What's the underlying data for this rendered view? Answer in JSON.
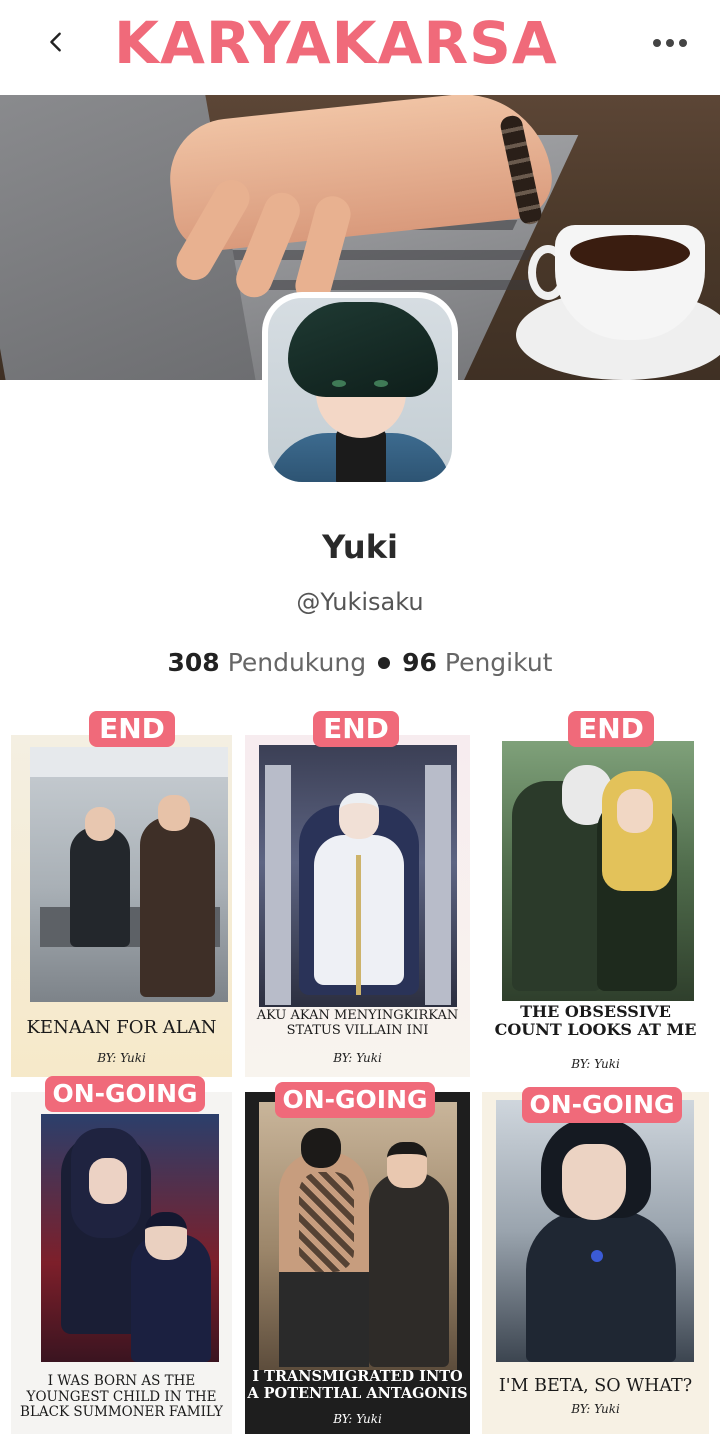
{
  "header": {
    "title": "KARYAKARSA",
    "back_icon": "chevron-left-icon",
    "more_icon": "more-horizontal-icon",
    "accent_color": "#f06a7a"
  },
  "profile": {
    "name": "Yuki",
    "handle": "@Yukisaku",
    "supporters_count": "308",
    "supporters_label": "Pendukung",
    "followers_count": "96",
    "followers_label": "Pengikut"
  },
  "books": [
    {
      "status": "END",
      "title_lines": [
        "KENAAN FOR ALAN"
      ],
      "byline": "BY: Yuki"
    },
    {
      "status": "END",
      "title_lines": [
        "AKU AKAN MENYINGKIRKAN",
        "STATUS VILLAIN INI"
      ],
      "byline": "BY: Yuki"
    },
    {
      "status": "END",
      "title_lines": [
        "THE OBSESSIVE",
        "COUNT LOOKS AT ME"
      ],
      "byline": "BY: Yuki"
    },
    {
      "status": "ON-GOING",
      "title_lines": [
        "I WAS BORN AS THE",
        "YOUNGEST CHILD IN THE",
        "BLACK SUMMONER FAMILY"
      ],
      "byline": ""
    },
    {
      "status": "ON-GOING",
      "title_lines": [
        "I TRANSMIGRATED INTO",
        "A POTENTIAL ANTAGONIS"
      ],
      "byline": "BY: Yuki"
    },
    {
      "status": "ON-GOING",
      "title_lines": [
        "I'M BETA, SO WHAT?"
      ],
      "byline": "BY: Yuki"
    }
  ]
}
